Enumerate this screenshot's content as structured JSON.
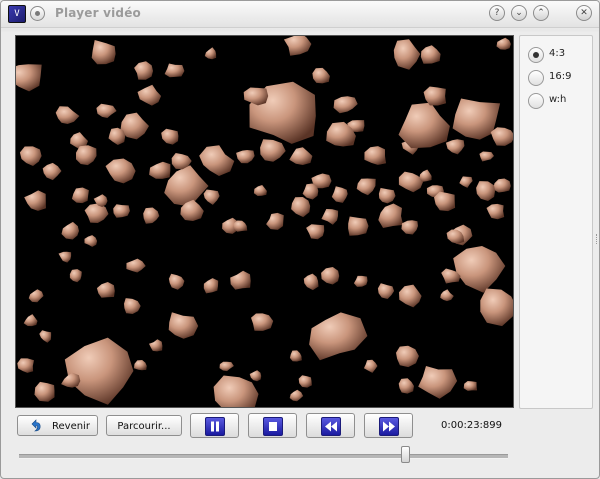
{
  "window": {
    "title": "Player vidéo",
    "app_icon_glyph": "V",
    "titlebar_buttons": [
      {
        "name": "help-icon",
        "glyph": "?"
      },
      {
        "name": "minimize-icon",
        "glyph": "⌄"
      },
      {
        "name": "maximize-icon",
        "glyph": "⌃"
      },
      {
        "name": "close-icon",
        "glyph": "✕"
      }
    ]
  },
  "aspect_ratios": {
    "options": [
      {
        "label": "4:3",
        "checked": true
      },
      {
        "label": "16:9",
        "checked": false
      },
      {
        "label": "w:h",
        "checked": false
      }
    ]
  },
  "controls": {
    "back_label": "Revenir",
    "back_icon": "back-arrow-icon",
    "browse_label": "Parcourir...",
    "pause_icon": "pause-icon",
    "stop_icon": "stop-icon",
    "rewind_icon": "rewind-icon",
    "forward_icon": "fast-forward-icon",
    "time": "0:00:23:899",
    "progress_fraction": 0.79
  },
  "video": {
    "content": "asteroid-field-scene",
    "colors": {
      "background": "#000000",
      "rock_light": "#e0b8a4",
      "rock_dark": "#8a5a48"
    }
  }
}
